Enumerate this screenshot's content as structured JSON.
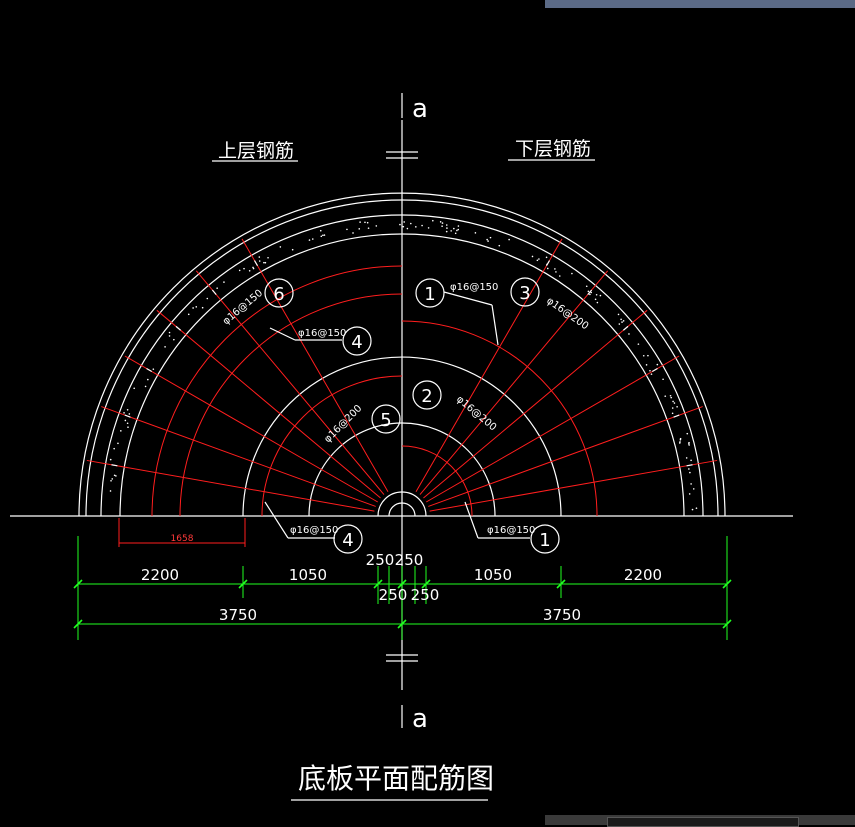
{
  "title": "底板平面配筋图",
  "section_mark": "a",
  "labels": {
    "upper_rebar": "上层钢筋",
    "lower_rebar": "下层钢筋",
    "red_dim": "1658"
  },
  "rebar_specs": {
    "spec_6": "φ16@150",
    "spec_4a": "φ16@150",
    "spec_5": "φ16@200",
    "spec_4b": "φ16@150",
    "spec_1a": "φ16@150",
    "spec_3": "φ16@200",
    "spec_2": "φ16@200",
    "spec_1b": "φ16@150"
  },
  "markers": {
    "m6": "6",
    "m4a": "4",
    "m5": "5",
    "m4b": "4",
    "m1a": "1",
    "m3": "3",
    "m2": "2",
    "m1b": "1"
  },
  "dimensions": {
    "left_outer": "2200",
    "left_inner": "1050",
    "center_l1": "250",
    "center_r1": "250",
    "center_l2": "250",
    "center_r2": "250",
    "right_inner": "1050",
    "right_outer": "2200",
    "left_total": "3750",
    "right_total": "3750"
  },
  "colors": {
    "background": "#000000",
    "line": "#ffffff",
    "rebar": "#ff1e1e",
    "dimension": "#20ff20"
  }
}
